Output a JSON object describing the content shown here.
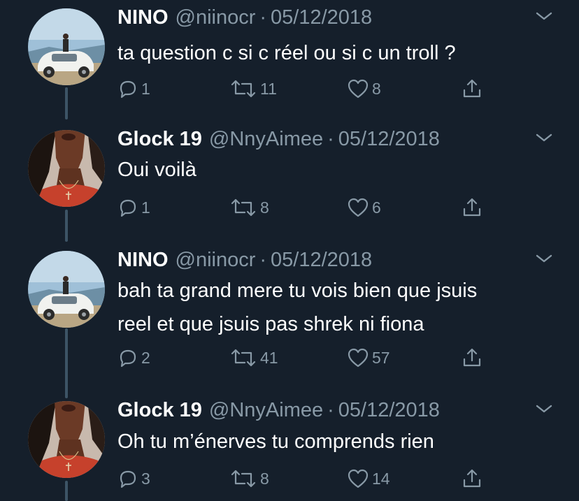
{
  "tweets": [
    {
      "name": "NINO",
      "handle": "@niinocr",
      "separator": "·",
      "date": "05/12/2018",
      "avatar": "car-avatar",
      "lines": [
        "ta question c si c réel ou si c un troll ?"
      ],
      "replies": "1",
      "retweets": "11",
      "likes": "8"
    },
    {
      "name": "Glock 19",
      "handle": "@NnyAimee",
      "separator": "·",
      "date": "05/12/2018",
      "avatar": "portrait-avatar",
      "lines": [
        "Oui voilà"
      ],
      "replies": "1",
      "retweets": "8",
      "likes": "6"
    },
    {
      "name": "NINO",
      "handle": "@niinocr",
      "separator": "·",
      "date": "05/12/2018",
      "avatar": "car-avatar",
      "lines": [
        "bah ta grand mere tu vois bien que jsuis",
        "reel et que jsuis pas shrek ni fiona"
      ],
      "replies": "2",
      "retweets": "41",
      "likes": "57"
    },
    {
      "name": "Glock 19",
      "handle": "@NnyAimee",
      "separator": "·",
      "date": "05/12/2018",
      "avatar": "portrait-avatar",
      "lines": [
        "Oh tu m’énerves tu comprends rien"
      ],
      "replies": "3",
      "retweets": "8",
      "likes": "14"
    }
  ],
  "icons": {
    "reply": "reply-icon",
    "retweet": "retweet-icon",
    "like": "heart-icon",
    "share": "share-icon",
    "more": "chevron-down-icon"
  },
  "colors": {
    "background": "#151f2b",
    "text": "#ffffff",
    "secondary": "#8899a6",
    "thread_line": "#3d5466"
  }
}
